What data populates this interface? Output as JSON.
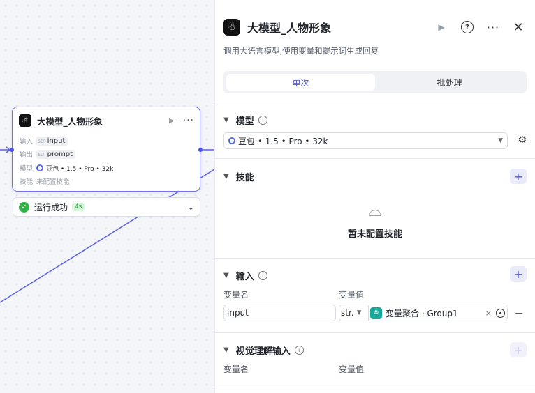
{
  "node": {
    "title": "大模型_人物形象",
    "input_label": "输入",
    "input_type": "str.",
    "input_name": "input",
    "output_label": "输出",
    "output_type": "str.",
    "output_name": "prompt",
    "model_label": "模型",
    "model_name": "豆包 • 1.5 • Pro • 32k",
    "skill_label": "技能",
    "skill_value": "未配置技能"
  },
  "status": {
    "text": "运行成功",
    "duration": "4s"
  },
  "panel": {
    "title": "大模型_人物形象",
    "description": "调用大语言模型,使用变量和提示词生成回复",
    "tabs": [
      {
        "label": "单次",
        "active": true
      },
      {
        "label": "批处理",
        "active": false
      }
    ],
    "model_section": {
      "title": "模型",
      "selected": "豆包 • 1.5 • Pro • 32k"
    },
    "skills_section": {
      "title": "技能",
      "empty_text": "暂未配置技能"
    },
    "input_section": {
      "title": "输入",
      "col_name": "变量名",
      "col_value": "变量值",
      "rows": [
        {
          "name": "input",
          "type": "str.",
          "ref": "变量聚合 · Group1"
        }
      ]
    },
    "vision_section": {
      "title": "视觉理解输入",
      "col_name": "变量名",
      "col_value": "变量值"
    }
  },
  "colors": {
    "accent": "#4d53e8",
    "success": "#2fb344",
    "ref_icon": "#14a99a"
  }
}
